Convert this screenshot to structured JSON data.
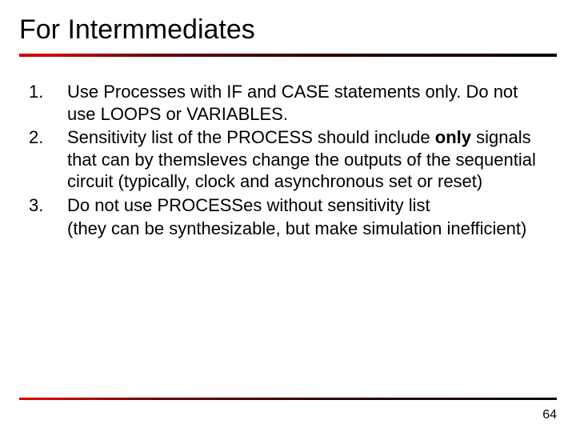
{
  "title": "For Intermmediates",
  "items": [
    {
      "num": "1.",
      "text": "Use Processes with IF and CASE statements only. Do not use LOOPS or VARIABLES."
    },
    {
      "num": "2.",
      "pre": "Sensitivity list of the PROCESS should include ",
      "bold": "only",
      "post": " signals that can by themsleves change the outputs of the sequential circuit (typically, clock and asynchronous set or reset)"
    },
    {
      "num": "3.",
      "text": "Do not use PROCESSes without sensitivity list",
      "cont": "(they can be synthesizable, but make simulation inefficient)"
    }
  ],
  "page_number": "64"
}
